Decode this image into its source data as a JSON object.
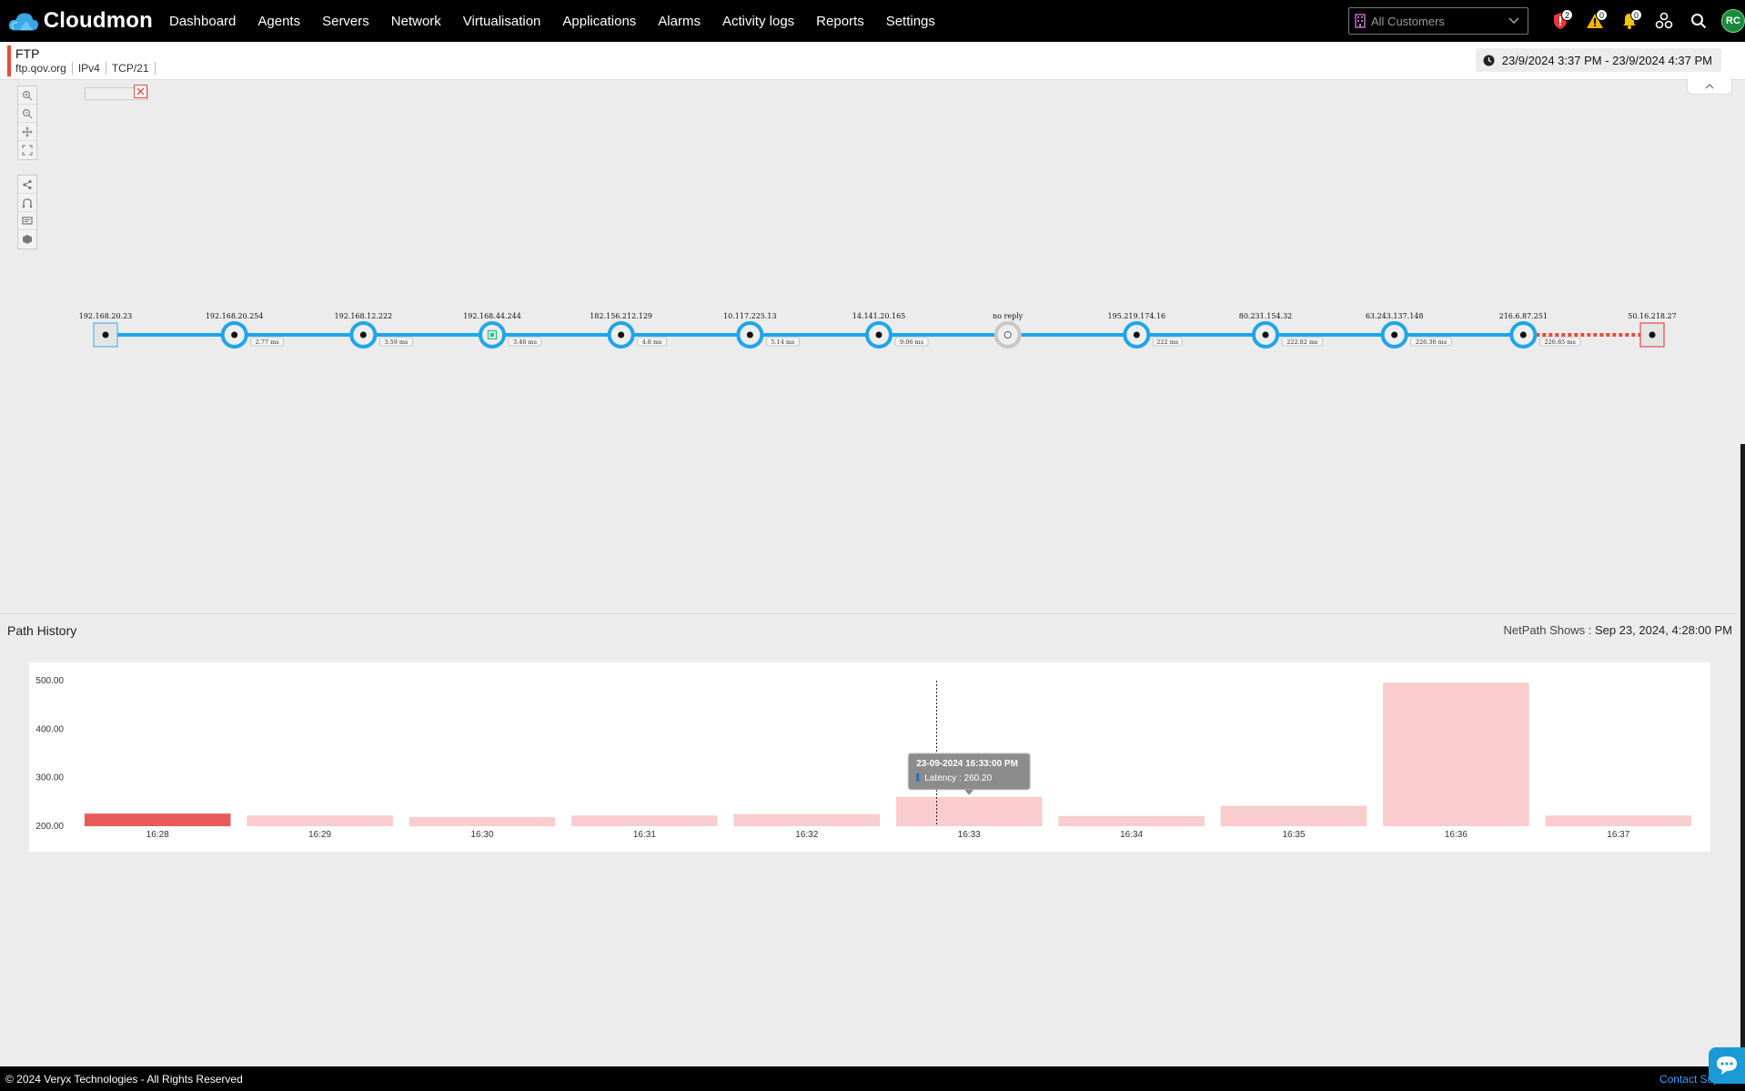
{
  "brand": {
    "name": "Cloudmon",
    "logo_icon": "cloud-logo-icon"
  },
  "nav": [
    "Dashboard",
    "Agents",
    "Servers",
    "Network",
    "Virtualisation",
    "Applications",
    "Alarms",
    "Activity logs",
    "Reports",
    "Settings"
  ],
  "customer_select": {
    "placeholder": "All Customers"
  },
  "top_icons": {
    "security_badge": "2",
    "warning_badge": "0",
    "notification_badge": "0",
    "avatar_initials": "RC"
  },
  "subheader": {
    "title": "FTP",
    "host": "ftp.qov.org",
    "ip_version": "IPv4",
    "protocol": "TCP/21",
    "date_range": "23/9/2024 3:37 PM - 23/9/2024 4:37 PM"
  },
  "path": {
    "hops": [
      {
        "ip": "192.168.20.23",
        "latency": "",
        "kind": "source"
      },
      {
        "ip": "192.168.20.254",
        "latency": "2.77 ms",
        "kind": "hop"
      },
      {
        "ip": "192.168.12.222",
        "latency": "3.59 ms",
        "kind": "hop"
      },
      {
        "ip": "192.168.44.244",
        "latency": "3.46 ms",
        "kind": "hop-green"
      },
      {
        "ip": "182.156.212.129",
        "latency": "4.8 ms",
        "kind": "hop"
      },
      {
        "ip": "10.117.225.13",
        "latency": "5.14 ms",
        "kind": "hop"
      },
      {
        "ip": "14.141.20.165",
        "latency": "9.06 ms",
        "kind": "hop"
      },
      {
        "ip": "no reply",
        "latency": "",
        "kind": "noreply"
      },
      {
        "ip": "195.219.174.16",
        "latency": "222 ms",
        "kind": "hop"
      },
      {
        "ip": "80.231.154.32",
        "latency": "222.82 ms",
        "kind": "hop"
      },
      {
        "ip": "63.243.137.148",
        "latency": "226.36 ms",
        "kind": "hop"
      },
      {
        "ip": "216.6.87.251",
        "latency": "226.85 ms",
        "kind": "hop"
      },
      {
        "ip": "50.16.218.27",
        "latency": "",
        "kind": "destination"
      }
    ],
    "colors": {
      "line": "#1ea5ec",
      "bad_link": "#e74c3c",
      "node_fill": "#eeeeee",
      "green": "#1fbf8f"
    }
  },
  "path_history": {
    "title": "Path History",
    "shows_label": "NetPath Shows :",
    "shows_value": "Sep 23, 2024, 4:28:00 PM"
  },
  "chart_data": {
    "type": "bar",
    "categories": [
      "16:28",
      "16:29",
      "16:30",
      "16:31",
      "16:32",
      "16:33",
      "16:34",
      "16:35",
      "16:36",
      "16:37"
    ],
    "values": [
      226,
      222,
      219,
      222,
      225,
      260.2,
      221,
      242,
      496,
      222
    ],
    "selected_index": 0,
    "ylim": [
      200,
      500
    ],
    "yticks": [
      "200.00",
      "300.00",
      "400.00",
      "500.00"
    ],
    "colors": {
      "bar": "#f9cdcd",
      "selected_bar": "#e85a5a"
    },
    "tooltip": {
      "title": "23-09-2024 16:33:00 PM",
      "label": "Latency : 260.20",
      "category_index": 5
    }
  },
  "footer": {
    "copyright": "© 2024 Veryx Technologies - All Rights Reserved",
    "contact": "Contact Sup"
  }
}
